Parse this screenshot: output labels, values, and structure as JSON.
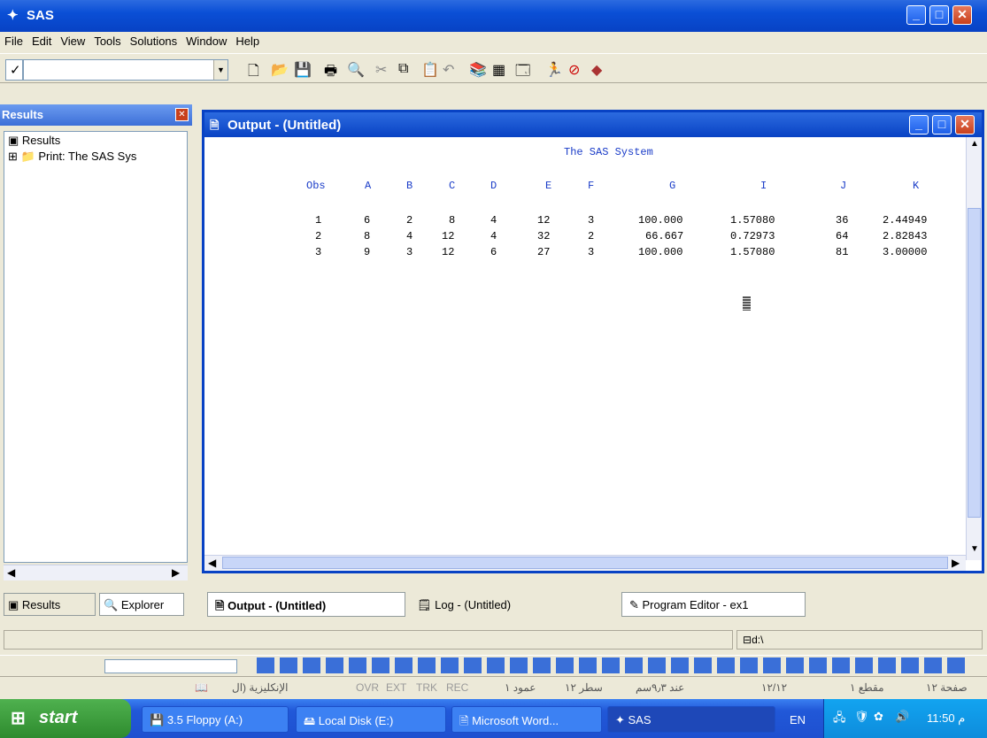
{
  "window": {
    "title": "SAS"
  },
  "menu": [
    "File",
    "Edit",
    "View",
    "Tools",
    "Solutions",
    "Window",
    "Help"
  ],
  "toolbar": {
    "command_value": ""
  },
  "results_panel": {
    "title": "Results",
    "tree": [
      {
        "label": "Results"
      },
      {
        "label": "Print:  The SAS Sys"
      }
    ],
    "tabs": [
      {
        "label": "Results"
      },
      {
        "label": "Explorer"
      }
    ]
  },
  "output_window": {
    "title": "Output - (Untitled)",
    "heading": "The SAS System",
    "columns": [
      "Obs",
      "A",
      "B",
      "C",
      "D",
      "E",
      "F",
      "G",
      "I",
      "J",
      "K"
    ],
    "rows": [
      [
        "1",
        "6",
        "2",
        "8",
        "4",
        "12",
        "3",
        "100.000",
        "1.57080",
        "36",
        "2.44949"
      ],
      [
        "2",
        "8",
        "4",
        "12",
        "4",
        "32",
        "2",
        "66.667",
        "0.72973",
        "64",
        "2.82843"
      ],
      [
        "3",
        "9",
        "3",
        "12",
        "6",
        "27",
        "3",
        "100.000",
        "1.57080",
        "81",
        "3.00000"
      ]
    ]
  },
  "window_tabs": [
    {
      "label": "Output - (Untitled)"
    },
    {
      "label": "Log - (Untitled)"
    },
    {
      "label": "Program Editor - ex1"
    }
  ],
  "status": {
    "path": "d:\\"
  },
  "word_status": {
    "page": "صفحة ١٢",
    "section": "مقطع ١",
    "pages": "١٢/١٢",
    "at": "عند ٩٫٣سم",
    "line": "سطر ١٢",
    "col": "عمود ١",
    "rec": "REC",
    "trk": "TRK",
    "ext": "EXT",
    "ovr": "OVR",
    "lang": "الإنكليزية (ال"
  },
  "taskbar": {
    "start": "start",
    "items": [
      {
        "label": "3.5 Floppy (A:)"
      },
      {
        "label": "Local Disk (E:)"
      },
      {
        "label": "Microsoft Word..."
      },
      {
        "label": "SAS"
      }
    ],
    "lang": "EN",
    "clock": "11:50 م"
  }
}
